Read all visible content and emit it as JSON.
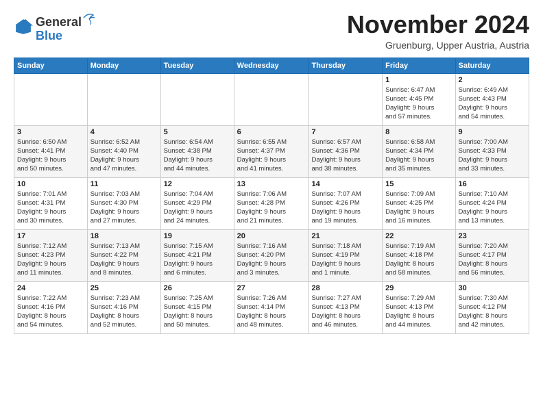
{
  "logo": {
    "general": "General",
    "blue": "Blue"
  },
  "title": "November 2024",
  "location": "Gruenburg, Upper Austria, Austria",
  "weekdays": [
    "Sunday",
    "Monday",
    "Tuesday",
    "Wednesday",
    "Thursday",
    "Friday",
    "Saturday"
  ],
  "weeks": [
    [
      {
        "day": "",
        "info": ""
      },
      {
        "day": "",
        "info": ""
      },
      {
        "day": "",
        "info": ""
      },
      {
        "day": "",
        "info": ""
      },
      {
        "day": "",
        "info": ""
      },
      {
        "day": "1",
        "info": "Sunrise: 6:47 AM\nSunset: 4:45 PM\nDaylight: 9 hours\nand 57 minutes."
      },
      {
        "day": "2",
        "info": "Sunrise: 6:49 AM\nSunset: 4:43 PM\nDaylight: 9 hours\nand 54 minutes."
      }
    ],
    [
      {
        "day": "3",
        "info": "Sunrise: 6:50 AM\nSunset: 4:41 PM\nDaylight: 9 hours\nand 50 minutes."
      },
      {
        "day": "4",
        "info": "Sunrise: 6:52 AM\nSunset: 4:40 PM\nDaylight: 9 hours\nand 47 minutes."
      },
      {
        "day": "5",
        "info": "Sunrise: 6:54 AM\nSunset: 4:38 PM\nDaylight: 9 hours\nand 44 minutes."
      },
      {
        "day": "6",
        "info": "Sunrise: 6:55 AM\nSunset: 4:37 PM\nDaylight: 9 hours\nand 41 minutes."
      },
      {
        "day": "7",
        "info": "Sunrise: 6:57 AM\nSunset: 4:36 PM\nDaylight: 9 hours\nand 38 minutes."
      },
      {
        "day": "8",
        "info": "Sunrise: 6:58 AM\nSunset: 4:34 PM\nDaylight: 9 hours\nand 35 minutes."
      },
      {
        "day": "9",
        "info": "Sunrise: 7:00 AM\nSunset: 4:33 PM\nDaylight: 9 hours\nand 33 minutes."
      }
    ],
    [
      {
        "day": "10",
        "info": "Sunrise: 7:01 AM\nSunset: 4:31 PM\nDaylight: 9 hours\nand 30 minutes."
      },
      {
        "day": "11",
        "info": "Sunrise: 7:03 AM\nSunset: 4:30 PM\nDaylight: 9 hours\nand 27 minutes."
      },
      {
        "day": "12",
        "info": "Sunrise: 7:04 AM\nSunset: 4:29 PM\nDaylight: 9 hours\nand 24 minutes."
      },
      {
        "day": "13",
        "info": "Sunrise: 7:06 AM\nSunset: 4:28 PM\nDaylight: 9 hours\nand 21 minutes."
      },
      {
        "day": "14",
        "info": "Sunrise: 7:07 AM\nSunset: 4:26 PM\nDaylight: 9 hours\nand 19 minutes."
      },
      {
        "day": "15",
        "info": "Sunrise: 7:09 AM\nSunset: 4:25 PM\nDaylight: 9 hours\nand 16 minutes."
      },
      {
        "day": "16",
        "info": "Sunrise: 7:10 AM\nSunset: 4:24 PM\nDaylight: 9 hours\nand 13 minutes."
      }
    ],
    [
      {
        "day": "17",
        "info": "Sunrise: 7:12 AM\nSunset: 4:23 PM\nDaylight: 9 hours\nand 11 minutes."
      },
      {
        "day": "18",
        "info": "Sunrise: 7:13 AM\nSunset: 4:22 PM\nDaylight: 9 hours\nand 8 minutes."
      },
      {
        "day": "19",
        "info": "Sunrise: 7:15 AM\nSunset: 4:21 PM\nDaylight: 9 hours\nand 6 minutes."
      },
      {
        "day": "20",
        "info": "Sunrise: 7:16 AM\nSunset: 4:20 PM\nDaylight: 9 hours\nand 3 minutes."
      },
      {
        "day": "21",
        "info": "Sunrise: 7:18 AM\nSunset: 4:19 PM\nDaylight: 9 hours\nand 1 minute."
      },
      {
        "day": "22",
        "info": "Sunrise: 7:19 AM\nSunset: 4:18 PM\nDaylight: 8 hours\nand 58 minutes."
      },
      {
        "day": "23",
        "info": "Sunrise: 7:20 AM\nSunset: 4:17 PM\nDaylight: 8 hours\nand 56 minutes."
      }
    ],
    [
      {
        "day": "24",
        "info": "Sunrise: 7:22 AM\nSunset: 4:16 PM\nDaylight: 8 hours\nand 54 minutes."
      },
      {
        "day": "25",
        "info": "Sunrise: 7:23 AM\nSunset: 4:16 PM\nDaylight: 8 hours\nand 52 minutes."
      },
      {
        "day": "26",
        "info": "Sunrise: 7:25 AM\nSunset: 4:15 PM\nDaylight: 8 hours\nand 50 minutes."
      },
      {
        "day": "27",
        "info": "Sunrise: 7:26 AM\nSunset: 4:14 PM\nDaylight: 8 hours\nand 48 minutes."
      },
      {
        "day": "28",
        "info": "Sunrise: 7:27 AM\nSunset: 4:13 PM\nDaylight: 8 hours\nand 46 minutes."
      },
      {
        "day": "29",
        "info": "Sunrise: 7:29 AM\nSunset: 4:13 PM\nDaylight: 8 hours\nand 44 minutes."
      },
      {
        "day": "30",
        "info": "Sunrise: 7:30 AM\nSunset: 4:12 PM\nDaylight: 8 hours\nand 42 minutes."
      }
    ]
  ]
}
